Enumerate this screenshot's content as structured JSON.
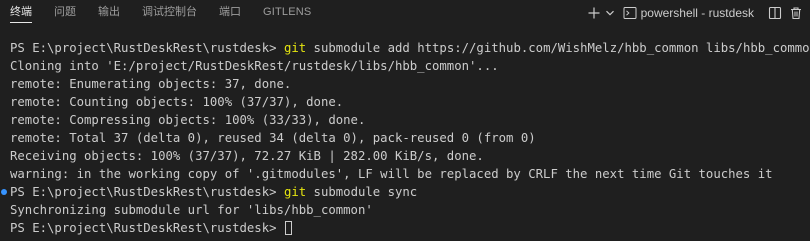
{
  "tabs": [
    {
      "label": "终端",
      "active": true
    },
    {
      "label": "问题",
      "active": false
    },
    {
      "label": "输出",
      "active": false
    },
    {
      "label": "调试控制台",
      "active": false
    },
    {
      "label": "端口",
      "active": false
    },
    {
      "label": "GITLENS",
      "active": false
    }
  ],
  "toolbar": {
    "new_terminal_icon": "plus-icon",
    "dropdown_icon": "chevron-down-icon",
    "terminal_profile_label": "powershell - rustdesk",
    "split_icon": "split-editor-icon",
    "delete_icon": "trash-icon"
  },
  "terminal": {
    "lines": [
      {
        "prompt": "PS E:\\project\\RustDeskRest\\rustdesk> ",
        "command": "git",
        "rest": " submodule add https://github.com/WishMelz/hbb_common libs/hbb_common",
        "decorated": false
      },
      {
        "text": "Cloning into 'E:/project/RustDeskRest/rustdesk/libs/hbb_common'..."
      },
      {
        "text": "remote: Enumerating objects: 37, done."
      },
      {
        "text": "remote: Counting objects: 100% (37/37), done."
      },
      {
        "text": "remote: Compressing objects: 100% (33/33), done."
      },
      {
        "text": "remote: Total 37 (delta 0), reused 34 (delta 0), pack-reused 0 (from 0)"
      },
      {
        "text": "Receiving objects: 100% (37/37), 72.27 KiB | 282.00 KiB/s, done."
      },
      {
        "text": "warning: in the working copy of '.gitmodules', LF will be replaced by CRLF the next time Git touches it"
      },
      {
        "prompt": "PS E:\\project\\RustDeskRest\\rustdesk> ",
        "command": "git",
        "rest": " submodule sync",
        "decorated": true
      },
      {
        "text": "Synchronizing submodule url for 'libs/hbb_common'"
      },
      {
        "prompt": "PS E:\\project\\RustDeskRest\\rustdesk> ",
        "command": "",
        "rest": "",
        "decorated": false,
        "cursor": true
      }
    ]
  },
  "colors": {
    "background": "#1f1f1f",
    "text": "#cccccc",
    "command": "#e5e510",
    "decoration_dot": "#3794ff",
    "active_tab": "#e7e7e7",
    "inactive_tab": "#9d9d9d"
  }
}
